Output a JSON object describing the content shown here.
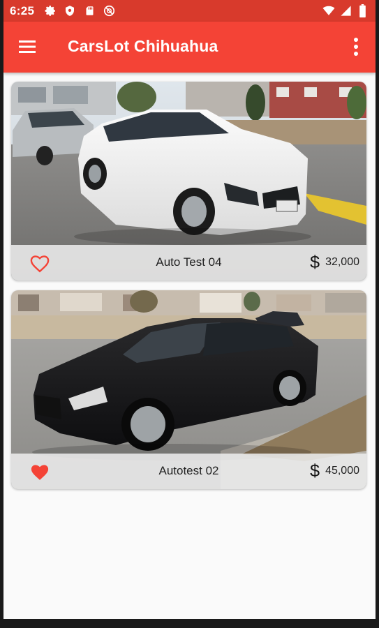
{
  "status_bar": {
    "time": "6:25",
    "left_icons": [
      "gear-icon",
      "shield-icon",
      "sd-card-icon",
      "no-disturb-icon"
    ],
    "right_icons": [
      "wifi-icon",
      "signal-icon",
      "battery-icon"
    ]
  },
  "app_bar": {
    "title": "CarsLot Chihuahua",
    "menu_icon": "hamburger-menu-icon",
    "overflow_icon": "more-vert-icon"
  },
  "cars": [
    {
      "name": "Auto Test 04",
      "price": "32,000",
      "currency_icon": "dollar-icon",
      "favorite": false,
      "photo": "white-sedan-photo"
    },
    {
      "name": "Autotest 02",
      "price": "45,000",
      "currency_icon": "dollar-icon",
      "favorite": true,
      "photo": "black-sedan-photo"
    }
  ],
  "colors": {
    "status_bar": "#d83a2c",
    "app_bar": "#f44336",
    "heart": "#f44336",
    "background": "#fafafa"
  }
}
